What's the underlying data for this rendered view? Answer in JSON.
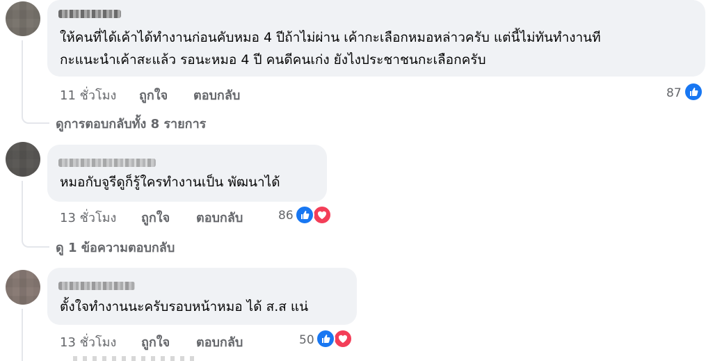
{
  "comments": [
    {
      "text_line1": "ให้คนที่ได้เค้าได้ทำงานก่อนคับหมอ 4 ปีถ้าไม่ผ่าน เค้ากะเลือกหมอหล่าวครับ แต่นี้ไม่ทันทำงานที",
      "text_line2": "กะแนะนำเค้าสะแล้ว รอนะหมอ 4 ปี คนดีคนเก่ง ยังไงประชาชนกะเลือกครับ",
      "time": "11 ชั่วโมง",
      "like_label": "ถูกใจ",
      "reply_label": "ตอบกลับ",
      "reaction_count": "87",
      "view_replies": "ดูการตอบกลับทั้ง 8 รายการ"
    },
    {
      "text_line1": "หมอกับจูรีดูก็รู้ใครทำงานเป็น พัฒนาได้",
      "time": "13 ชั่วโมง",
      "like_label": "ถูกใจ",
      "reply_label": "ตอบกลับ",
      "reaction_count": "86",
      "view_replies": "ดู 1 ข้อความตอบกลับ"
    },
    {
      "text_line1": "ตั้งใจทำงานนะครับรอบหน้าหมอ ได้ ส.ส แน่",
      "time": "13 ชั่วโมง",
      "like_label": "ถูกใจ",
      "reply_label": "ตอบกลับ",
      "reaction_count": "50"
    }
  ],
  "icons": {
    "like": "thumbs-up-icon",
    "love": "heart-icon"
  },
  "colors": {
    "like_blue": "#1877f2",
    "love_red": "#f33e58",
    "bubble_bg": "#f0f2f5",
    "meta_gray": "#65676b"
  }
}
